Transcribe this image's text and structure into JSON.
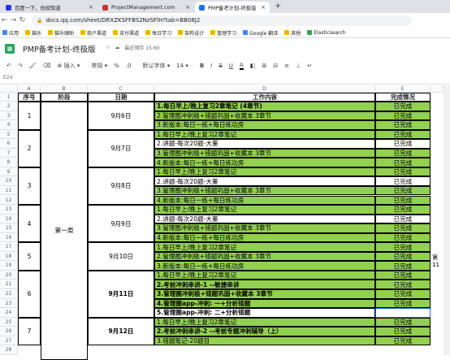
{
  "browser": {
    "tabs": [
      {
        "title": "百度一下，你就知道",
        "fav_color": "#2932e1",
        "active": false
      },
      {
        "title": "ProjectManagement.com",
        "fav_color": "#c0392b",
        "active": false
      },
      {
        "title": "PMP备考计划-终极版",
        "fav_color": "#1a73e8",
        "active": true
      }
    ],
    "new_tab": "+",
    "url": "docs.qq.com/sheet/DRXZKSFFBS2NzSFlH?tab=BB08J2",
    "bookmarks": [
      {
        "label": "应用",
        "color": "#4285f4"
      },
      {
        "label": "猫乐",
        "color": "#f4b400"
      },
      {
        "label": "猫乐辅助",
        "color": "#f4b400"
      },
      {
        "label": "商户渠道",
        "color": "#f4b400"
      },
      {
        "label": "支付渠道",
        "color": "#f4b400"
      },
      {
        "label": "每日学习",
        "color": "#f4b400"
      },
      {
        "label": "架构设计",
        "color": "#f4b400"
      },
      {
        "label": "管理学习",
        "color": "#f4b400"
      },
      {
        "label": "Google 翻译",
        "color": "#4285f4"
      },
      {
        "label": "其他",
        "color": "#f4b400"
      },
      {
        "label": "Elasticsearch",
        "color": "#34a853"
      }
    ]
  },
  "doc": {
    "title": "PMP备考计划-终极版",
    "status": "最近保存 15:60",
    "name_box": "E24"
  },
  "toolbar": {
    "insert": "插入",
    "format": "常规",
    "font": "默认字体",
    "size": "14",
    "bold": "B",
    "italic": "I",
    "strike": "S",
    "underline": "U",
    "font_color": "A"
  },
  "sheet": {
    "columns": [
      "A",
      "B",
      "C",
      "D",
      "E"
    ],
    "headers": [
      "序号",
      "阶段",
      "日期",
      "工作内容",
      "完成情况"
    ],
    "row_numbers": [
      "1",
      "2",
      "3",
      "4",
      "5",
      "6",
      "7",
      "8",
      "9",
      "10",
      "11",
      "12",
      "13",
      "14",
      "15",
      "16",
      "17",
      "18",
      "19",
      "20",
      "21",
      "22",
      "23",
      "24",
      "25",
      "26",
      "27",
      "28"
    ],
    "groups": [
      {
        "num": "1",
        "date": "9月6日"
      },
      {
        "num": "2",
        "date": "9月7日"
      },
      {
        "num": "3",
        "date": "9月8日"
      },
      {
        "num": "4",
        "date": "9月9日"
      },
      {
        "num": "5",
        "date": "9月10日"
      },
      {
        "num": "6",
        "date": "9月11日"
      },
      {
        "num": "7",
        "date": "9月12日"
      }
    ],
    "phase": "第一周",
    "rows": [
      {
        "content": "1.每日早上/晚上复习2章笔记  (4章节)",
        "status": "已完成"
      },
      {
        "content": "2.管理圈冲刺极+错题巩固+收藏本 3章节",
        "status": "已完成"
      },
      {
        "content": "3.新版本:每日一练+每日练功房",
        "status": "已完成"
      },
      {
        "content": "1.每日早上/晚上复习2章笔记",
        "status": "已完成"
      },
      {
        "content": "2.讲题-每次20题-大董",
        "status": "已完成"
      },
      {
        "content": "3.管理圈冲刺极+错题巩固+收藏本 3章节",
        "status": "已完成"
      },
      {
        "content": "4.新版本:每日一练+每日练功房",
        "status": "已完成"
      },
      {
        "content": "1.每日早上/晚上复习2章笔记",
        "status": "已完成"
      },
      {
        "content": "2.讲题-每次20题-大董",
        "status": "已完成"
      },
      {
        "content": "3.管理圈冲刺极+错题巩固+收藏本 3章节",
        "status": "已完成"
      },
      {
        "content": "4.新版本:每日一练+每日练功房",
        "status": "已完成"
      },
      {
        "content": "1.每日早上/晚上复习2章笔记",
        "status": "已完成"
      },
      {
        "content": "2.讲题-每次20题-大董",
        "status": "已完成"
      },
      {
        "content": "3.管理圈冲刺极+错题巩固+收藏本 3章节",
        "status": "已完成"
      },
      {
        "content": "4.新版本:每日一练+每日练功房",
        "status": "已完成"
      },
      {
        "content": "1.每日早上/晚上复习2章笔记",
        "status": "已完成"
      },
      {
        "content": "2.管理圈冲刺极+错题巩固+收藏本 3章节",
        "status": "已完成"
      },
      {
        "content": "3.新版本:每日一练+每日练功房",
        "status": "已完成"
      },
      {
        "content": "1.每日早上/晚上复习2章笔记",
        "status": "已完成"
      },
      {
        "content": "2.考前冲刺串讲-1 --敏捷串讲",
        "status": "已完成"
      },
      {
        "content": "3.管理圈冲刺极+错题巩固+收藏本 3章节",
        "status": "已完成"
      },
      {
        "content": "4.管理圈app-冲刺: 一+分析错题",
        "status": "已完成"
      },
      {
        "content": "5.管理圈app-冲刺: 二+分析错题",
        "status": ""
      },
      {
        "content": "1.每日早上/晚上复习2章笔记",
        "status": "已完成"
      },
      {
        "content": "2.考前冲刺串讲-2 --考前专题冲刺辅导（上）",
        "status": "已完成"
      },
      {
        "content": "3.错题笔记-20题目",
        "status": "已完成"
      }
    ],
    "side_note": "第11"
  }
}
